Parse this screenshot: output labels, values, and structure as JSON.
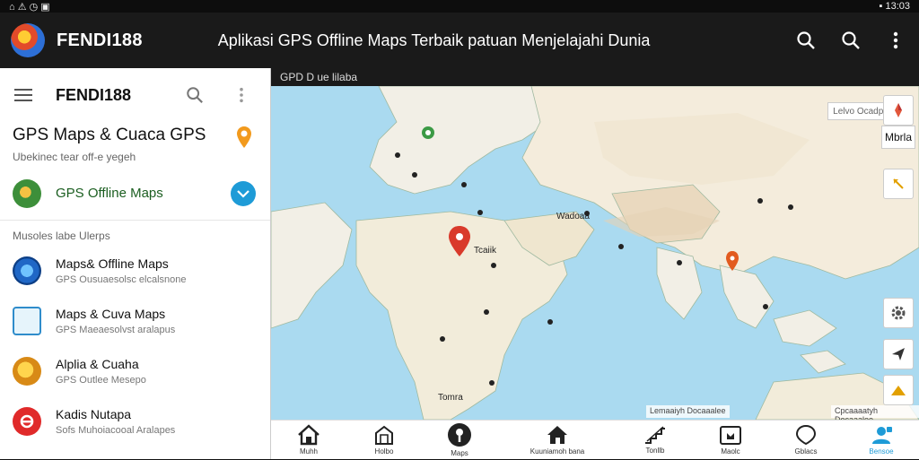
{
  "status_bar": {
    "left": "⌂ ⚠ ◷ ▣",
    "right": "▪ 13:03"
  },
  "appbar": {
    "name": "FENDI188",
    "tagline": "Aplikasi GPS Offline Maps Terbaik patuan Menjelajahi Dunia"
  },
  "sidebar": {
    "title": "FENDI188",
    "gps_title": "GPS Maps & Cuaca GPS",
    "gps_subtitle": "Ubekinec tear off-e yegeh",
    "offline_label": "GPS Offline Maps",
    "section_label": "Musoles labe Ulerps",
    "items": [
      {
        "title": "Maps& Offline Maps",
        "subtitle": "GPS Ousuaesolsc elcalsnone"
      },
      {
        "title": "Maps & Cuva Maps",
        "subtitle": "GPS Maeaesolvst aralapus"
      },
      {
        "title": "Alplia & Cuaha",
        "subtitle": "GPS Outlee Mesepo"
      },
      {
        "title": "Kadis Nutapa",
        "subtitle": "Sofs Muhoiacooal Aralapes"
      }
    ]
  },
  "map": {
    "header": "GPD D ue lilaba",
    "legend": "Lelvo Ocadpo",
    "metric": "Mbrla",
    "attribution_left": "Lemaaiyh Docaaalee",
    "attribution_right": "Cpcaaaatyh Docaaalee",
    "labels": [
      "Tcaiik",
      "Wadoaa",
      "Tomra"
    ],
    "colors": {
      "water": "#aadaf0",
      "land": "#f2efe6",
      "accent": "#1e9bd7",
      "pin": "#d93a2b"
    }
  },
  "bottom_nav": [
    "Muhh",
    "Holbo",
    "Maps",
    "Kuuniamoh bana",
    "Tonllb",
    "Maolc",
    "Gblacs",
    "Bensoe"
  ]
}
